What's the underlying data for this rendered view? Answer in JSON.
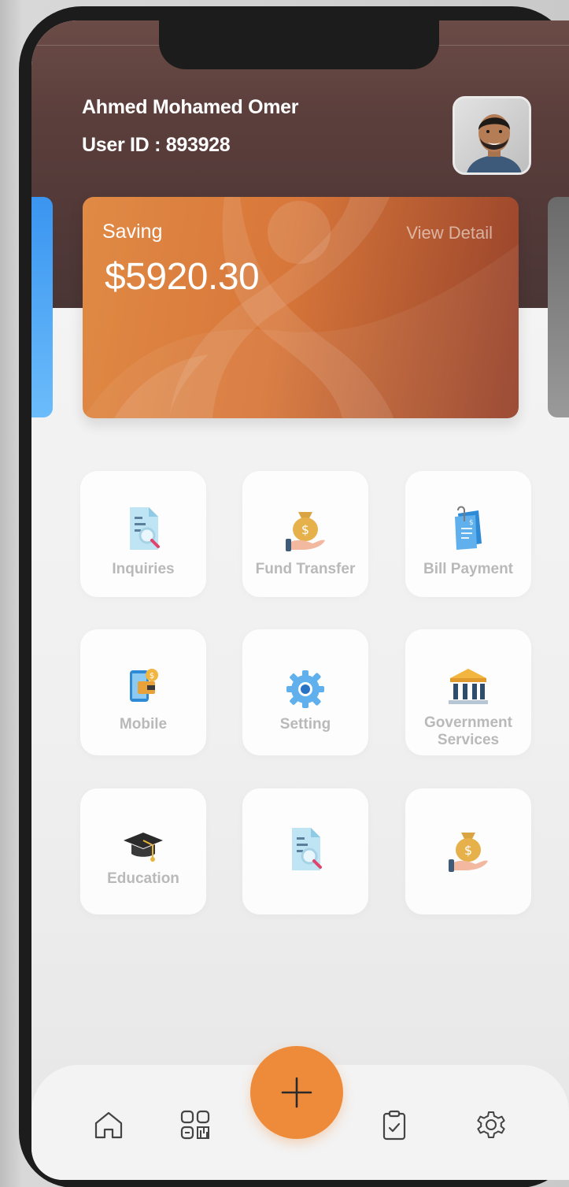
{
  "user": {
    "name": "Ahmed Mohamed Omer",
    "id_label": "User ID : 893928"
  },
  "card": {
    "type": "Saving",
    "view_detail": "View Detail",
    "balance": "$5920.30"
  },
  "services": [
    {
      "label": "Inquiries",
      "icon": "inquiries-icon"
    },
    {
      "label": "Fund Transfer",
      "icon": "money-bag-hand-icon"
    },
    {
      "label": "Bill Payment",
      "icon": "bill-icon"
    },
    {
      "label": "Mobile",
      "icon": "mobile-wallet-icon"
    },
    {
      "label": "Setting",
      "icon": "gear-icon"
    },
    {
      "label_line1": "Government",
      "label_line2": "Services",
      "icon": "bank-icon"
    },
    {
      "label": "Education",
      "icon": "graduation-cap-icon"
    },
    {
      "label": "",
      "icon": "inquiries-icon"
    },
    {
      "label": "",
      "icon": "money-bag-hand-icon"
    }
  ],
  "nav": {
    "items": [
      "home-icon",
      "qr-code-icon",
      "add-icon",
      "clipboard-check-icon",
      "settings-icon"
    ]
  },
  "colors": {
    "header": "#5a3e3b",
    "card_start": "#e08a45",
    "card_end": "#96412a",
    "fab": "#ee8b3a"
  }
}
